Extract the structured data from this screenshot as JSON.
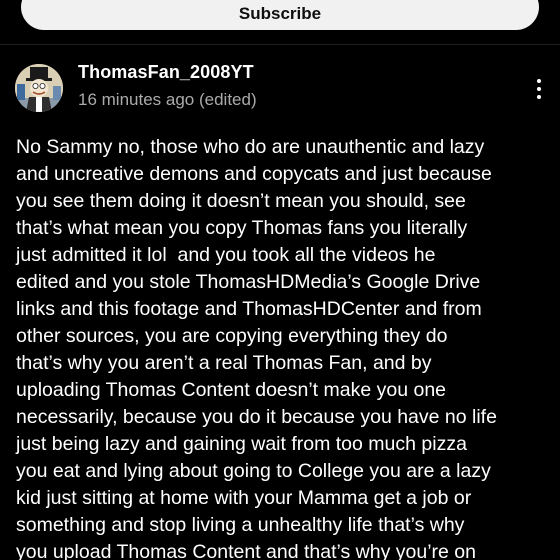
{
  "subscribe": {
    "label": "Subscribe"
  },
  "comment": {
    "author": "ThomasFan_2008YT",
    "timestamp": "16 minutes ago (edited)",
    "icons": {
      "avatar": "avatar-icon",
      "more": "more-vert-icon"
    },
    "lines": [
      "No Sammy no, those who do are unauthentic and lazy",
      "and uncreative demons and copycats and just because",
      "you see them doing it doesn’t mean you should, see",
      "that’s what mean you copy Thomas fans you literally",
      "just admitted it lol  and you took all the videos he",
      "edited and you stole ThomasHDMedia’s Google Drive",
      "links and this footage and ThomasHDCenter and from",
      "other sources, you are copying everything they do",
      "that’s why you aren’t a real Thomas Fan, and by",
      "uploading Thomas Content doesn’t make you one",
      "necessarily, because you do it because you have no life",
      "just being lazy and gaining wait from too much pizza",
      "you eat and lying about going to College you are a lazy",
      "kid just sitting at home with your Mamma get a job or",
      "something and stop living a unhealthy life that’s why",
      "you upload Thomas Content and that’s why you’re on"
    ]
  },
  "colors": {
    "background": "#000000",
    "text": "#ffffff",
    "secondary_text": "#aaaaaa",
    "button_bg": "#f1f1f1",
    "button_text": "#0f0f0f"
  }
}
